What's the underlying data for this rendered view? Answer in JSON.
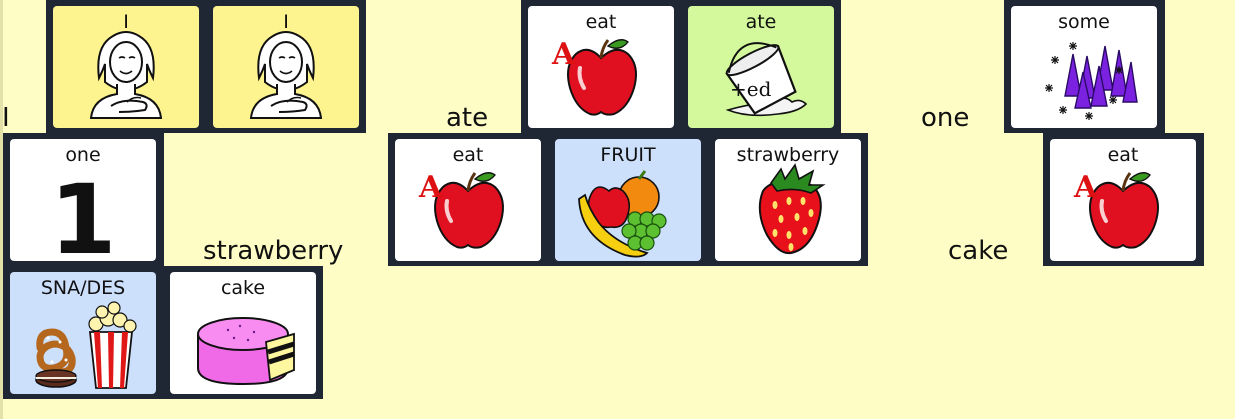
{
  "sentence": {
    "words": [
      "I",
      "ate",
      "one",
      "strawberry",
      "cake"
    ]
  },
  "tiles": {
    "i_1": "I",
    "i_2": "I",
    "eat_1": "eat",
    "ate": "ate",
    "ate_badge": "+ed",
    "some": "some",
    "one": "one",
    "one_numeral": "1",
    "eat_2": "eat",
    "fruit": "FRUIT",
    "strawberry": "strawberry",
    "eat_3": "eat",
    "snacks_desserts": "SNA/DES",
    "cake": "cake",
    "eat_letter": "A"
  },
  "colors": {
    "background": "#fffdc6",
    "strip": "#1f2735",
    "yellow_tile": "#fdf48f",
    "green_tile": "#d4f99c",
    "blue_tile": "#cce0fc",
    "white_tile": "#ffffff"
  },
  "icons": {
    "person": "woman-pointing-to-self-icon",
    "apple": "red-apple-icon",
    "spilled_pail": "spilled-pail-icon",
    "cones": "purple-cones-icon",
    "numeral": "number-one-icon",
    "fruit": "fruit-bundle-icon",
    "strawberry": "strawberry-icon",
    "snacks": "pretzel-popcorn-icon",
    "cake": "pink-cake-icon"
  }
}
